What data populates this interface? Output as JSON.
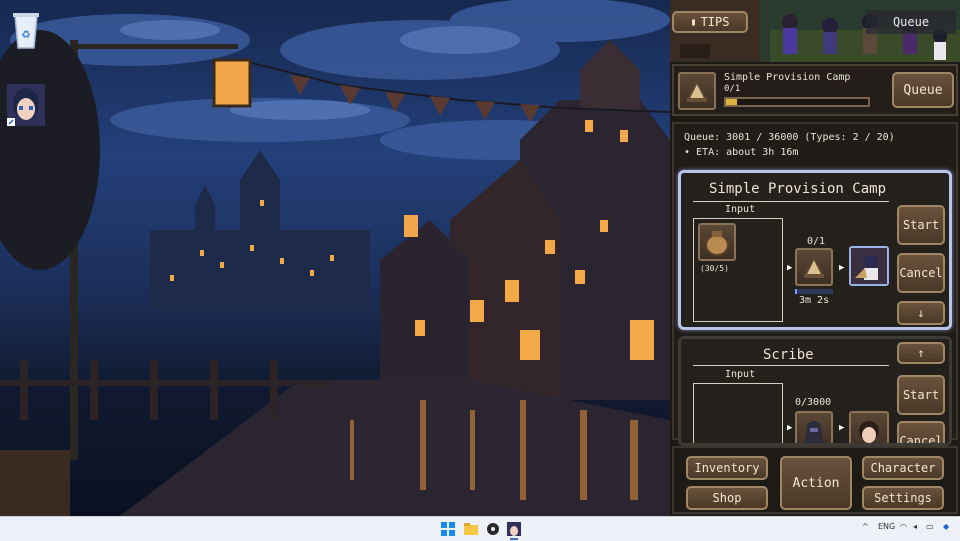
{
  "desktop": {
    "recycle_bin": "recycle-bin-icon",
    "shortcut": "game-character-shortcut-icon"
  },
  "header": {
    "tips_label": "TIPS",
    "queue_label": "Queue"
  },
  "current_task": {
    "title": "Simple Provision Camp",
    "count": "0/1",
    "progress": 0.08,
    "queue_button": "Queue"
  },
  "queue_summary": {
    "line1": "Queue: 3001 / 36000 (Types: 2 / 20)",
    "line2": "• ETA: about 3h 16m"
  },
  "cards": [
    {
      "title": "Simple Provision Camp",
      "input_label": "Input",
      "input_count": "(30/5)",
      "output_count": "0/1",
      "time": "3m 2s",
      "progress": 0.05,
      "buttons": {
        "start": "Start",
        "cancel": "Cancel",
        "down": "↓"
      }
    },
    {
      "title": "Scribe",
      "input_label": "Input",
      "output_count": "0/3000",
      "buttons": {
        "up": "↑",
        "start": "Start",
        "cancel": "Cancel"
      }
    }
  ],
  "nav": {
    "inventory": "Inventory",
    "shop": "Shop",
    "action": "Action",
    "character": "Character",
    "settings": "Settings"
  },
  "taskbar": {
    "icons": [
      "windows-start-icon",
      "file-explorer-icon",
      "app-icon",
      "game-icon"
    ],
    "tray_text": "ENG"
  },
  "colors": {
    "accent_border": "#a08764",
    "panel_bg": "#1d1915",
    "highlight_frame": "#b8c4e8"
  }
}
